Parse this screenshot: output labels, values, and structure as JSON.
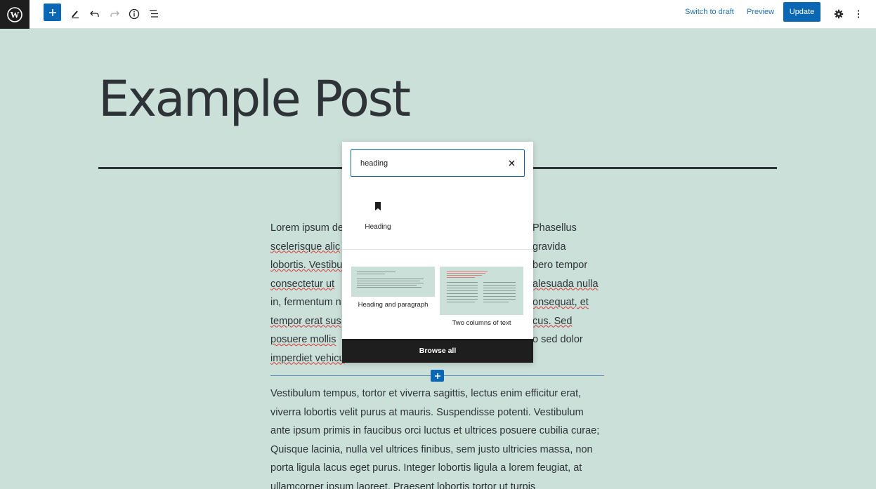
{
  "toolbar": {
    "switch_to_draft": "Switch to draft",
    "preview": "Preview",
    "update": "Update"
  },
  "post": {
    "title": "Example Post",
    "para1_plain": "Lorem ipsum de",
    "para1_seg1": "scelerisque alic",
    "para1_seg2": "lobortis. Vestibu",
    "para1_seg3": "consectetur ut",
    "para1_seg4": "in, fermentum n",
    "para1_seg5": "tempor erat sus",
    "para1_seg6": "posuere mollis",
    "para1_seg7": "imperdiet vehicu",
    "para1_r1": "Phasellus",
    "para1_r2": "gravida",
    "para1_r3": "bero tempor",
    "para1_r4": "alesuada nulla",
    "para1_r5": "onsequat, et",
    "para1_r6": "cus. Sed",
    "para1_r7": "o sed dolor",
    "para2": "Vestibulum tempus, tortor et viverra sagittis, lectus enim efficitur erat, viverra lobortis velit purus at mauris. Suspendisse potenti. Vestibulum ante ipsum primis in faucibus orci luctus et ultrices posuere cubilia curae; Quisque lacinia, nulla vel ultrices finibus, sem justo ultricies massa, non porta ligula lacus eget purus. Integer lobortis ligula a lorem feugiat, at ullamcorper ipsum laoreet. Praesent lobortis tortor ut turpis"
  },
  "inserter": {
    "search_value": "heading",
    "block_result": {
      "label": "Heading",
      "icon": "bookmark-icon"
    },
    "patterns": [
      {
        "label": "Heading and paragraph"
      },
      {
        "label": "Two columns of text"
      }
    ],
    "browse_all": "Browse all"
  },
  "colors": {
    "accent": "#0b66b4",
    "canvas": "#cbe0d9",
    "text": "#2e3338"
  }
}
